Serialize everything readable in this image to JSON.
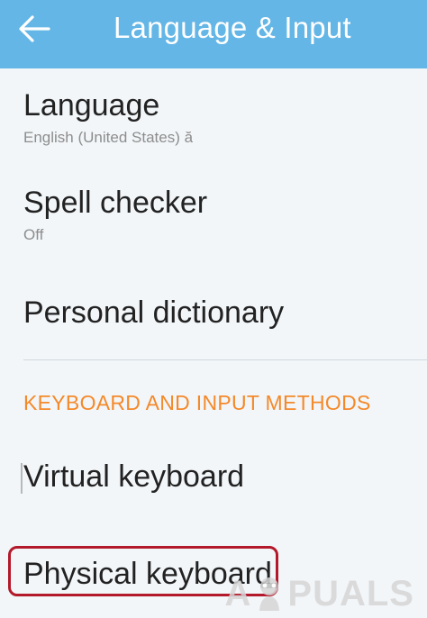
{
  "app_bar": {
    "title": "Language & Input",
    "back_icon": "arrow-left-icon",
    "background": "#64b6e6"
  },
  "settings": {
    "language": {
      "title": "Language",
      "summary": "English (United States) ă"
    },
    "spell_checker": {
      "title": "Spell checker",
      "summary": "Off"
    },
    "personal_dictionary": {
      "title": "Personal dictionary"
    }
  },
  "keyboard_section": {
    "header": "KEYBOARD AND INPUT METHODS",
    "header_color": "#f4892a",
    "virtual_keyboard": "Virtual keyboard",
    "physical_keyboard": "Physical keyboard"
  },
  "highlight": {
    "color": "#b3192a",
    "target": "Physical keyboard"
  },
  "watermark": {
    "text_a": "A",
    "text_b": "PUALS"
  }
}
